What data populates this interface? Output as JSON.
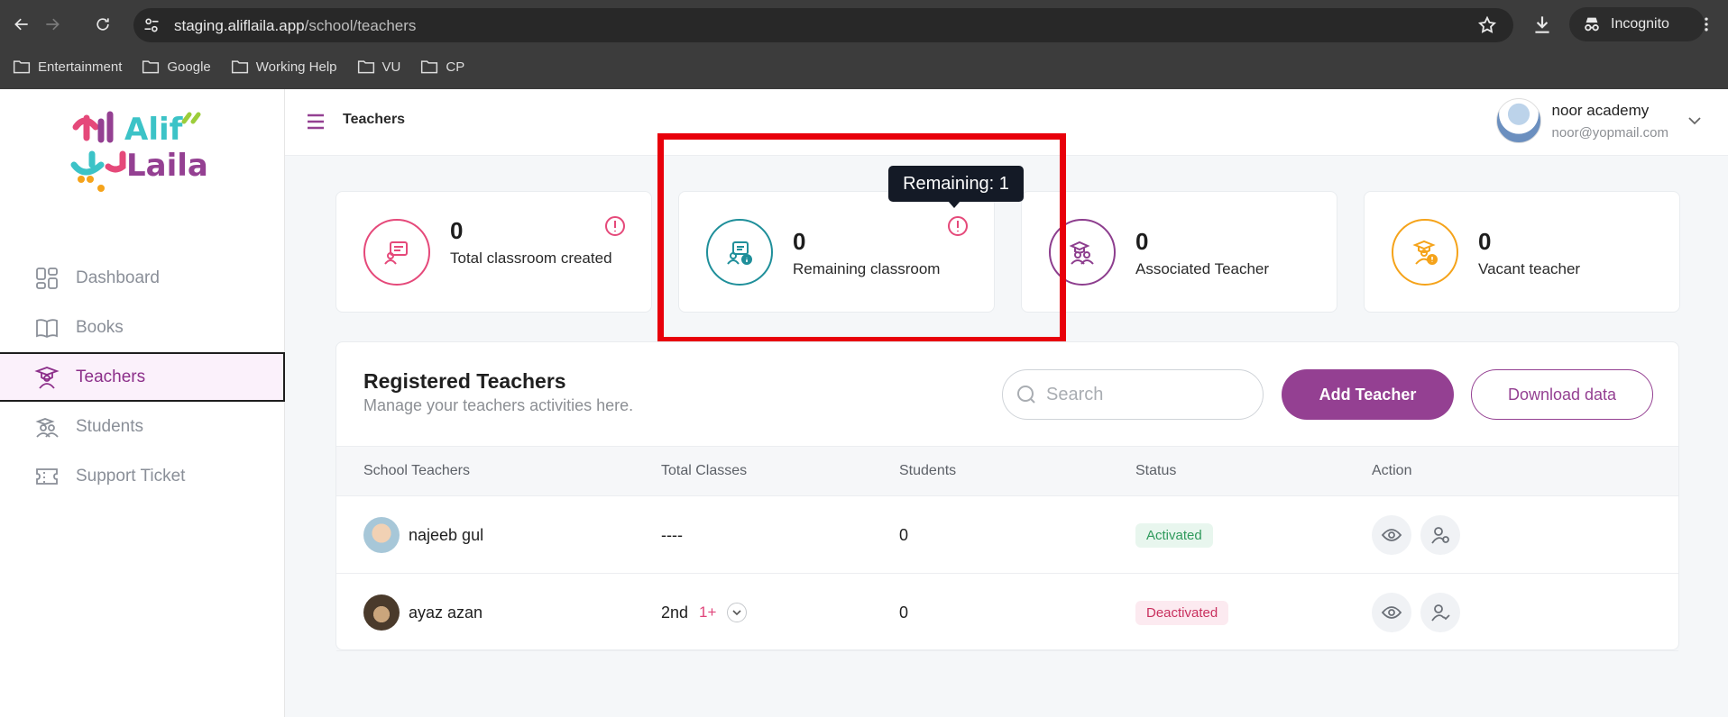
{
  "browser": {
    "url_host": "staging.aliflaila.app",
    "url_path": "/school/teachers",
    "incognito_label": "Incognito",
    "bookmarks": [
      "Entertainment",
      "Google",
      "Working Help",
      "VU",
      "CP"
    ]
  },
  "sidebar": {
    "items": [
      {
        "label": "Dashboard",
        "icon": "dashboard-icon"
      },
      {
        "label": "Books",
        "icon": "book-icon"
      },
      {
        "label": "Teachers",
        "icon": "teacher-icon",
        "active": true
      },
      {
        "label": "Students",
        "icon": "students-icon"
      },
      {
        "label": "Support Ticket",
        "icon": "ticket-icon"
      }
    ]
  },
  "header": {
    "title": "Teachers",
    "user_name": "noor academy",
    "user_email": "noor@yopmail.com"
  },
  "stats": [
    {
      "value": "0",
      "label": "Total classroom created",
      "color": "#e5497a"
    },
    {
      "value": "0",
      "label": "Remaining classroom",
      "color": "#1f8f9a"
    },
    {
      "value": "0",
      "label": "Associated Teacher",
      "color": "#8d3e8e"
    },
    {
      "value": "0",
      "label": "Vacant teacher",
      "color": "#f5a31a"
    }
  ],
  "tooltip": "Remaining: 1",
  "registered": {
    "title": "Registered Teachers",
    "subtitle": "Manage your teachers activities here.",
    "search_placeholder": "Search",
    "add_label": "Add Teacher",
    "download_label": "Download data",
    "columns": [
      "School Teachers",
      "Total Classes",
      "Students",
      "Status",
      "Action"
    ],
    "rows": [
      {
        "name": "najeeb gul",
        "classes": "----",
        "extra": "",
        "students": "0",
        "status": "Activated"
      },
      {
        "name": "ayaz azan",
        "classes": "2nd",
        "extra": "1+",
        "students": "0",
        "status": "Deactivated"
      }
    ]
  },
  "colors": {
    "brand": "#944092",
    "highlight": "#e8000b"
  }
}
